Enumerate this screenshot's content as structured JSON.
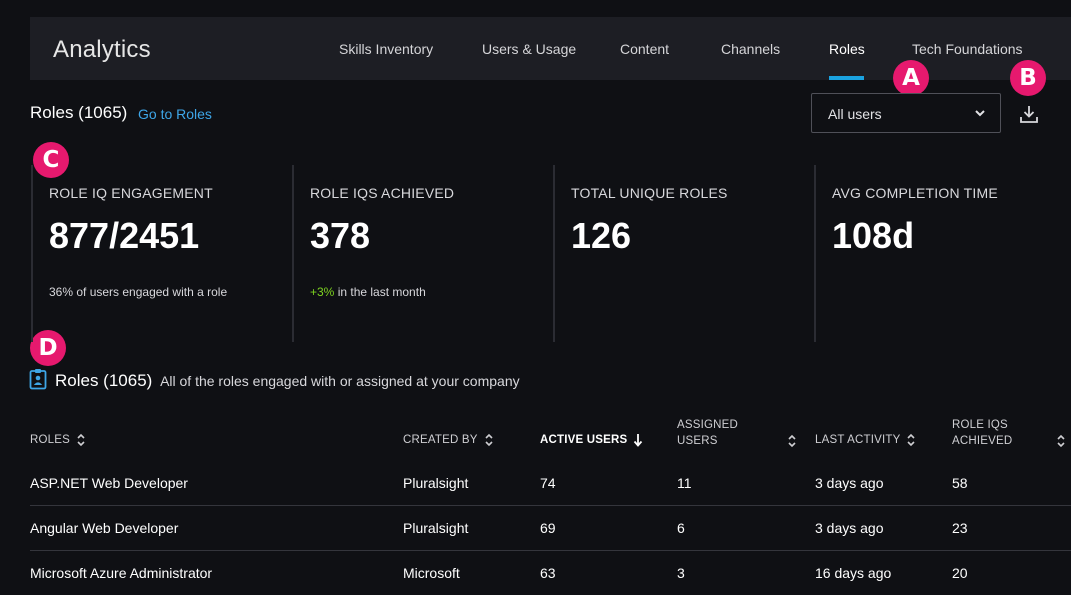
{
  "header": {
    "app_title": "Analytics",
    "tabs": [
      {
        "label": "Skills Inventory"
      },
      {
        "label": "Users & Usage"
      },
      {
        "label": "Content"
      },
      {
        "label": "Channels"
      },
      {
        "label": "Roles"
      },
      {
        "label": "Tech Foundations"
      }
    ],
    "active_tab": "Roles",
    "accent_color": "#1aa2e0"
  },
  "callouts": [
    "A",
    "B",
    "C",
    "D"
  ],
  "callout_color": "#e6196e",
  "section": {
    "title": "Roles (1065)",
    "link": "Go to Roles"
  },
  "filter": {
    "selected": "All users",
    "icon": "chevron-down-icon"
  },
  "download_icon": "download-icon",
  "stats": [
    {
      "label": "ROLE IQ ENGAGEMENT",
      "value": "877/2451",
      "sub": "36% of users engaged with a role"
    },
    {
      "label": "ROLE IQS ACHIEVED",
      "value": "378",
      "sub_highlight": "+3%",
      "sub": " in the last month"
    },
    {
      "label": "TOTAL UNIQUE ROLES",
      "value": "126",
      "sub": ""
    },
    {
      "label": "AVG COMPLETION TIME",
      "value": "108d",
      "sub": ""
    }
  ],
  "positive_color": "#7ed321",
  "roles_table": {
    "icon": "id-badge-icon",
    "title": "Roles (1065)",
    "description": "All of the roles engaged with or assigned at your company",
    "columns": {
      "roles": "ROLES",
      "created_by": "CREATED BY",
      "active_users": "ACTIVE USERS",
      "assigned_users_1": "ASSIGNED",
      "assigned_users_2": "USERS",
      "last_activity": "LAST ACTIVITY",
      "role_iqs_1": "ROLE IQS",
      "role_iqs_2": "ACHIEVED"
    },
    "rows": [
      {
        "role": "ASP.NET Web Developer",
        "created_by": "Pluralsight",
        "active_users": "74",
        "assigned_users": "11",
        "last_activity": "3 days ago",
        "role_iqs": "58"
      },
      {
        "role": "Angular Web Developer",
        "created_by": "Pluralsight",
        "active_users": "69",
        "assigned_users": "6",
        "last_activity": "3 days ago",
        "role_iqs": "23"
      },
      {
        "role": "Microsoft Azure Administrator",
        "created_by": "Microsoft",
        "active_users": "63",
        "assigned_users": "3",
        "last_activity": "16 days ago",
        "role_iqs": "20"
      }
    ]
  }
}
